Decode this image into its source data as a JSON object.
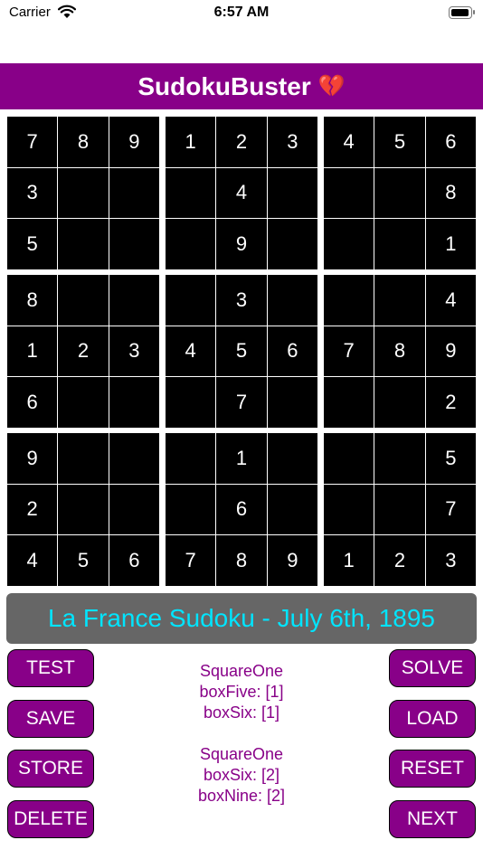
{
  "status": {
    "carrier": "Carrier",
    "time": "6:57 AM"
  },
  "title": {
    "text": "SudokuBuster",
    "emoji": "💔"
  },
  "grid": [
    [
      "7",
      "8",
      "9",
      "1",
      "2",
      "3",
      "4",
      "5",
      "6"
    ],
    [
      "3",
      "",
      "",
      "",
      "4",
      "",
      "",
      "",
      "8"
    ],
    [
      "5",
      "",
      "",
      "",
      "9",
      "",
      "",
      "",
      "1"
    ],
    [
      "8",
      "",
      "",
      "",
      "3",
      "",
      "",
      "",
      "4"
    ],
    [
      "1",
      "2",
      "3",
      "4",
      "5",
      "6",
      "7",
      "8",
      "9"
    ],
    [
      "6",
      "",
      "",
      "",
      "7",
      "",
      "",
      "",
      "2"
    ],
    [
      "9",
      "",
      "",
      "",
      "1",
      "",
      "",
      "",
      "5"
    ],
    [
      "2",
      "",
      "",
      "",
      "6",
      "",
      "",
      "",
      "7"
    ],
    [
      "4",
      "5",
      "6",
      "7",
      "8",
      "9",
      "1",
      "2",
      "3"
    ]
  ],
  "puzzle_title": "La France Sudoku - July 6th, 1895",
  "buttons": {
    "test": "TEST",
    "save": "SAVE",
    "store": "STORE",
    "delete": "DELETE",
    "solve": "SOLVE",
    "load": "LOAD",
    "reset": "RESET",
    "next": "NEXT"
  },
  "info": [
    {
      "line1": "SquareOne",
      "line2": "boxFive: [1]",
      "line3": "boxSix: [1]"
    },
    {
      "line1": "SquareOne",
      "line2": "boxSix: [2]",
      "line3": "boxNine: [2]"
    }
  ],
  "colors": {
    "accent": "#880088",
    "puzzle_title_text": "#00e5ff",
    "puzzle_title_bg": "#666666"
  }
}
